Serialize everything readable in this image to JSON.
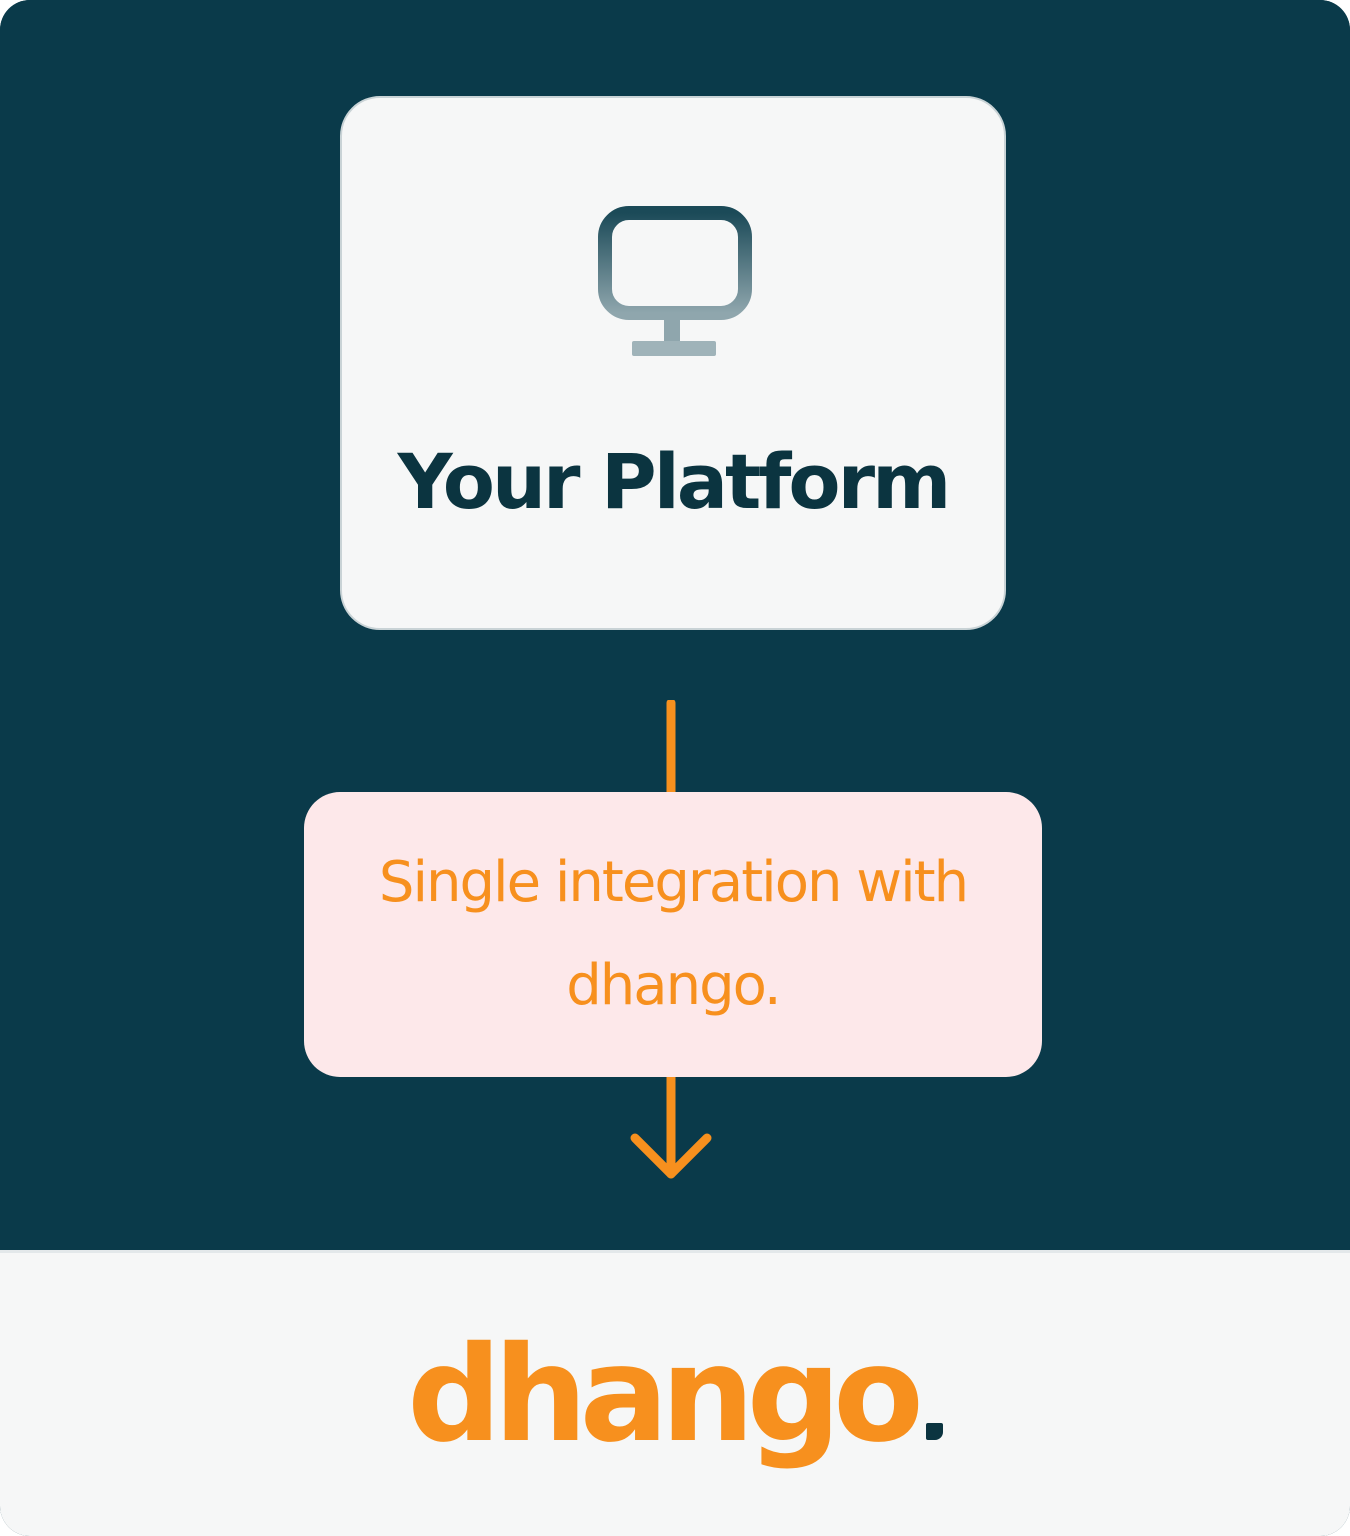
{
  "colors": {
    "background_dark": "#0a3a4a",
    "panel_light": "#f6f7f7",
    "accent_orange": "#f7901e",
    "integration_box": "#fde8ea",
    "text_dark": "#0b3440"
  },
  "platform": {
    "icon": "monitor-icon",
    "title": "Your Platform"
  },
  "integration": {
    "line1": "Single integration with",
    "line2": "dhango."
  },
  "arrow": {
    "icon": "arrow-down-icon"
  },
  "footer": {
    "logo_text": "dhango"
  }
}
